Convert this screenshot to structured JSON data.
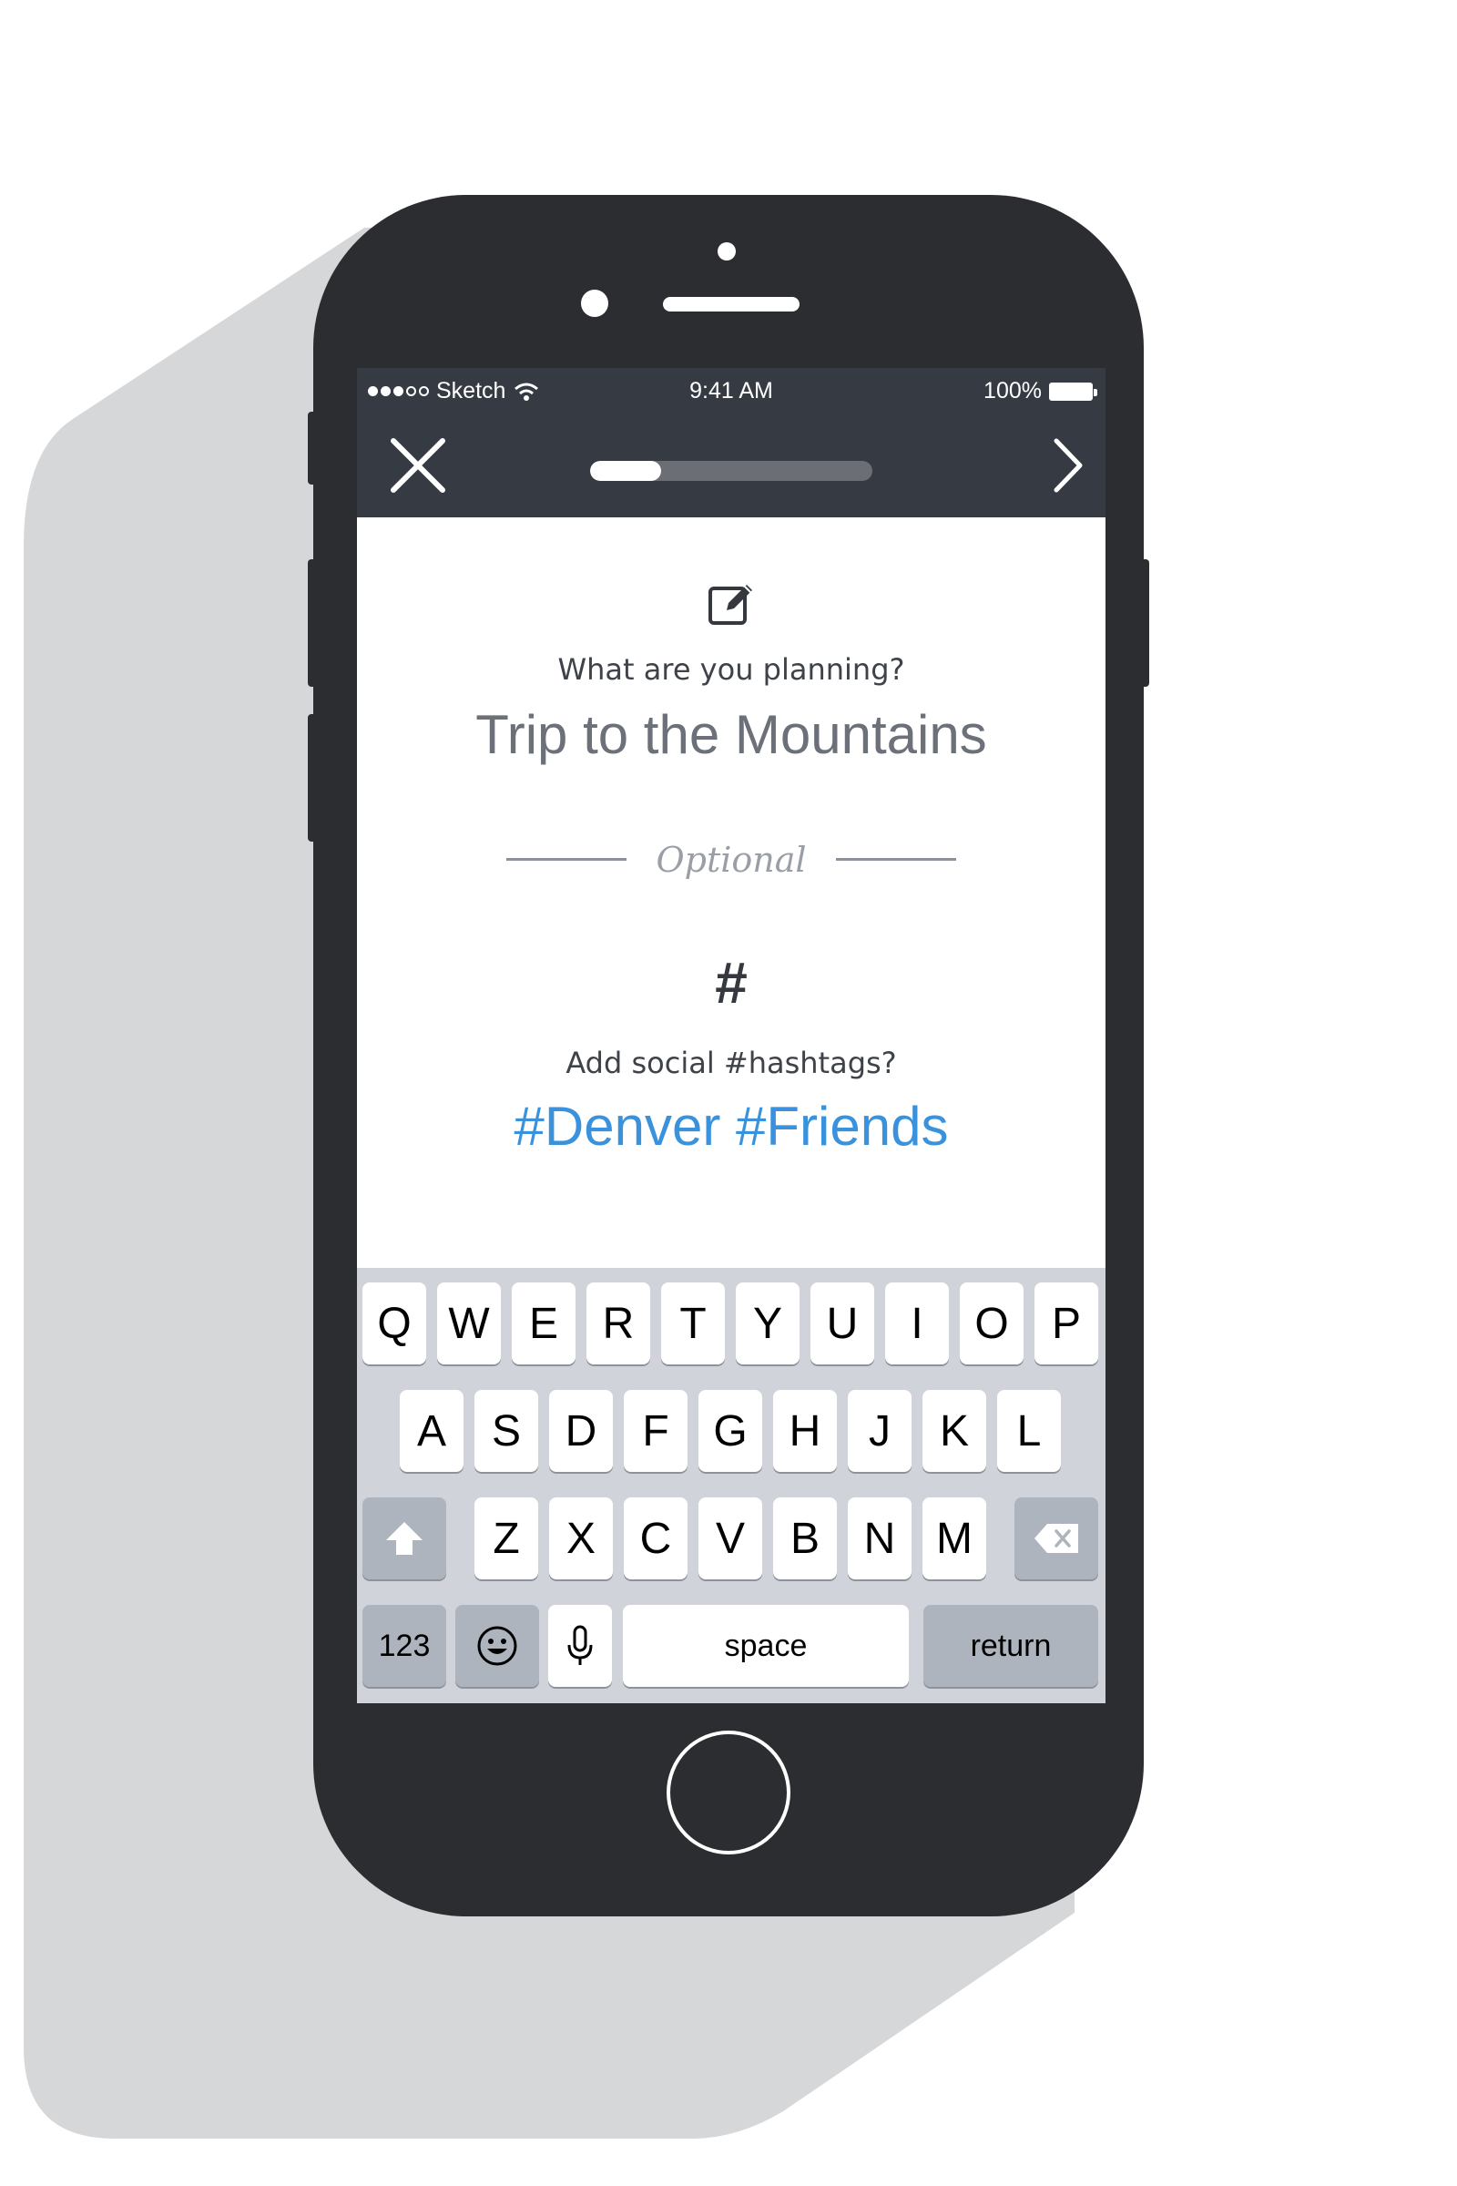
{
  "status_bar": {
    "carrier": "Sketch",
    "time": "9:41 AM",
    "battery": "100%",
    "signal_bars_filled": 3,
    "signal_bars_total": 5
  },
  "nav": {
    "close_icon": "close-icon",
    "next_icon": "chevron-right-icon",
    "progress": 0.25
  },
  "plan": {
    "icon": "edit-icon",
    "question": "What are you planning?",
    "answer": "Trip to the Mountains"
  },
  "divider": {
    "label": "Optional"
  },
  "hashtags": {
    "icon_glyph": "#",
    "question": "Add social #hashtags?",
    "answer": "#Denver #Friends"
  },
  "keyboard": {
    "row1": [
      "Q",
      "W",
      "E",
      "R",
      "T",
      "Y",
      "U",
      "I",
      "O",
      "P"
    ],
    "row2": [
      "A",
      "S",
      "D",
      "F",
      "G",
      "H",
      "J",
      "K",
      "L"
    ],
    "row3": [
      "Z",
      "X",
      "C",
      "V",
      "B",
      "N",
      "M"
    ],
    "numbers_label": "123",
    "space_label": "space",
    "return_label": "return"
  },
  "colors": {
    "bar_bg": "#353a43",
    "accent_blue": "#3a92dd",
    "phone_body": "#2c2d30"
  }
}
